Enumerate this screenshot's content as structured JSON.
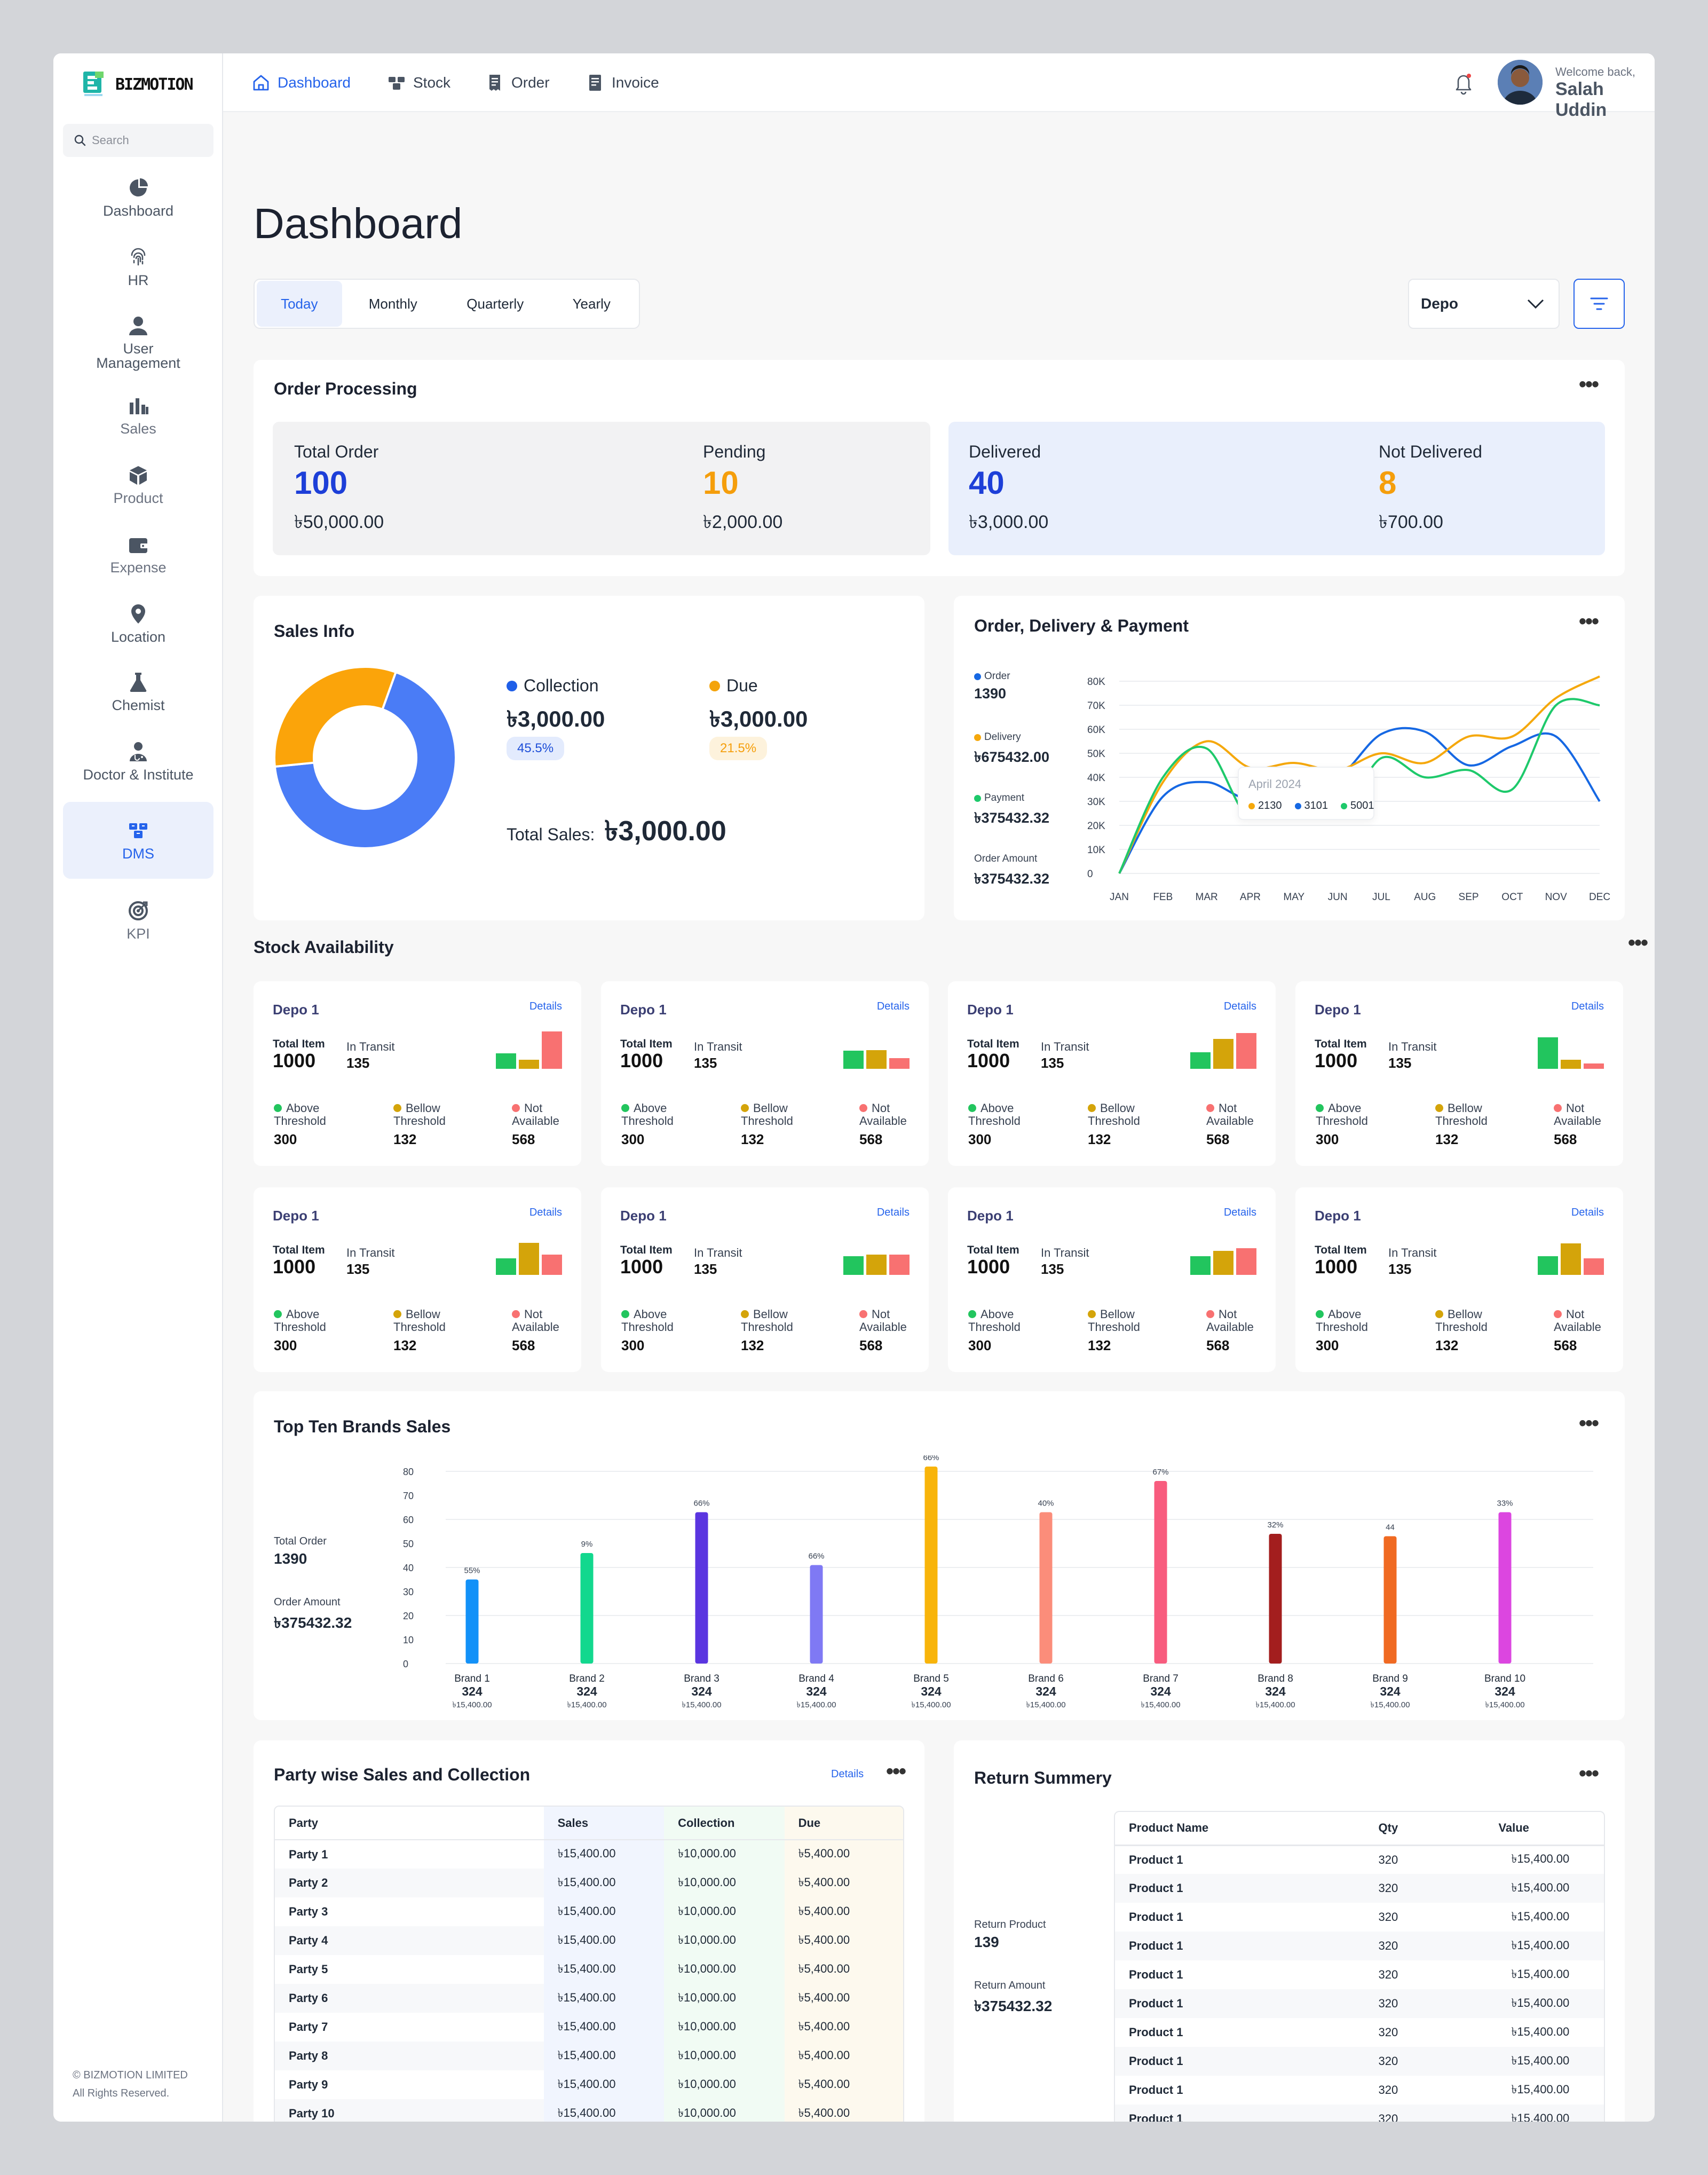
{
  "brand": {
    "logo_text": "BIZMOTION",
    "copyright_line1": "© BIZMOTION LIMITED",
    "copyright_line2": "All Rights Reserved."
  },
  "search": {
    "placeholder": "Search"
  },
  "sidebar": {
    "items": [
      {
        "label": "Dashboard",
        "icon": "pie-chart-icon"
      },
      {
        "label": "HR",
        "icon": "fingerprint-icon"
      },
      {
        "label": "User Management",
        "icon": "user-icon"
      },
      {
        "label": "Sales",
        "icon": "bar-chart-icon"
      },
      {
        "label": "Product",
        "icon": "box-icon"
      },
      {
        "label": "Expense",
        "icon": "wallet-icon"
      },
      {
        "label": "Location",
        "icon": "location-pin-icon"
      },
      {
        "label": "Chemist",
        "icon": "flask-icon"
      },
      {
        "label": "Doctor & Institute",
        "icon": "doctor-icon"
      },
      {
        "label": "DMS",
        "icon": "boxes-icon"
      },
      {
        "label": "KPI",
        "icon": "target-icon"
      }
    ],
    "active": "DMS"
  },
  "topnav": {
    "items": [
      {
        "label": "Dashboard",
        "icon": "home-icon"
      },
      {
        "label": "Stock",
        "icon": "boxes-icon"
      },
      {
        "label": "Order",
        "icon": "receipt-icon"
      },
      {
        "label": "Invoice",
        "icon": "invoice-icon"
      }
    ],
    "active": "Dashboard"
  },
  "user": {
    "welcome": "Welcome back,",
    "name": "Salah Uddin"
  },
  "page": {
    "title": "Dashboard"
  },
  "period_tabs": [
    "Today",
    "Monthly",
    "Quarterly",
    "Yearly"
  ],
  "active_tab": "Today",
  "depo_select": {
    "value": "Depo"
  },
  "order_processing": {
    "title": "Order Processing",
    "stats": [
      {
        "label": "Total Order",
        "value": "100",
        "amount": "৳50,000.00",
        "color": "#1d3fd8"
      },
      {
        "label": "Pending",
        "value": "10",
        "amount": "৳2,000.00",
        "color": "#f59e0b"
      },
      {
        "label": "Delivered",
        "value": "40",
        "amount": "৳3,000.00",
        "color": "#1d3fd8"
      },
      {
        "label": "Not Delivered",
        "value": "8",
        "amount": "৳700.00",
        "color": "#f59e0b"
      }
    ]
  },
  "sales_info": {
    "title": "Sales Info",
    "collection": {
      "label": "Collection",
      "amount": "৳3,000.00",
      "percent": "45.5%",
      "color": "#4a7cf6"
    },
    "due": {
      "label": "Due",
      "amount": "৳3,000.00",
      "percent": "21.5%",
      "color": "#fba40a"
    },
    "total_label": "Total Sales:",
    "total_value": "৳3,000.00"
  },
  "odp": {
    "title": "Order, Delivery & Payment",
    "legend": [
      {
        "label": "Order",
        "value": "1390",
        "color": "#1668e3"
      },
      {
        "label": "Delivery",
        "value": "৳675432.00",
        "color": "#f5a80c"
      },
      {
        "label": "Payment",
        "value": "৳375432.32",
        "color": "#1ec96b"
      },
      {
        "label": "Order Amount",
        "value": "৳375432.32",
        "color": ""
      }
    ],
    "tooltip": {
      "title": "April 2024",
      "items": [
        {
          "value": "2130",
          "color": "#f5a80c"
        },
        {
          "value": "3101",
          "color": "#1668e3"
        },
        {
          "value": "5001",
          "color": "#1ec96b"
        }
      ]
    }
  },
  "chart_data": [
    {
      "type": "line",
      "x": [
        "JAN",
        "FEB",
        "MAR",
        "APR",
        "MAY",
        "JUN",
        "JUL",
        "AUG",
        "SEP",
        "OCT",
        "NOV",
        "DEC"
      ],
      "yticks": [
        "80K",
        "70K",
        "60K",
        "50K",
        "40K",
        "30K",
        "20K",
        "10K",
        "0"
      ],
      "ylim": [
        0,
        80000
      ],
      "series": [
        {
          "name": "Order",
          "color": "#1668e3",
          "values": [
            0,
            32000,
            38000,
            31000,
            40000,
            40000,
            58000,
            59000,
            45000,
            53000,
            57000,
            30000
          ]
        },
        {
          "name": "Delivery",
          "color": "#f5a80c",
          "values": [
            0,
            38000,
            55000,
            44000,
            46000,
            43000,
            50000,
            46000,
            57000,
            57000,
            73000,
            82000
          ]
        },
        {
          "name": "Payment",
          "color": "#1ec96b",
          "values": [
            0,
            40000,
            52000,
            23000,
            38000,
            23000,
            48000,
            40000,
            43000,
            35000,
            70000,
            70000
          ]
        }
      ],
      "grid": true
    },
    {
      "type": "bar",
      "categories": [
        "Brand 1",
        "Brand 2",
        "Brand 3",
        "Brand 4",
        "Brand 5",
        "Brand 6",
        "Brand 7",
        "Brand 8",
        "Brand 9",
        "Brand 10"
      ],
      "values": [
        35,
        46,
        63,
        41,
        82,
        63,
        76,
        54,
        53,
        63
      ],
      "labels": [
        "55%",
        "9%",
        "66%",
        "66%",
        "66%",
        "40%",
        "67%",
        "32%",
        "44",
        "33%"
      ],
      "counts": [
        "324",
        "324",
        "324",
        "324",
        "324",
        "324",
        "324",
        "324",
        "324",
        "324"
      ],
      "amounts": [
        "৳15,400.00",
        "৳15,400.00",
        "৳15,400.00",
        "৳15,400.00",
        "৳15,400.00",
        "৳15,400.00",
        "৳15,400.00",
        "৳15,400.00",
        "৳15,400.00",
        "৳15,400.00"
      ],
      "colors": [
        "#1291f8",
        "#12d88e",
        "#5a35e0",
        "#7f79f4",
        "#f8b40a",
        "#fb8d7a",
        "#f85c7e",
        "#a31e1e",
        "#f06a22",
        "#dc46e0"
      ],
      "yticks": [
        "80",
        "70",
        "60",
        "50",
        "40",
        "30",
        "20",
        "10",
        "0"
      ],
      "ylim": [
        0,
        80
      ],
      "grid": true
    }
  ],
  "stock": {
    "title": "Stock Availability",
    "total_label": "Total Item",
    "transit_label": "In Transit",
    "details_label": "Details",
    "legend": [
      {
        "line1": "Above",
        "line2": "Threshold",
        "color": "#22c55e"
      },
      {
        "line1": "Bellow",
        "line2": "Threshold",
        "color": "#d4a40a"
      },
      {
        "line1": "Not",
        "line2": "Available",
        "color": "#f87171"
      }
    ],
    "cards": [
      {
        "name": "Depo 1",
        "total": "1000",
        "transit": "135",
        "values": [
          "300",
          "132",
          "568"
        ],
        "bars": [
          0.42,
          0.24,
          1.0
        ]
      },
      {
        "name": "Depo 1",
        "total": "1000",
        "transit": "135",
        "values": [
          "300",
          "132",
          "568"
        ],
        "bars": [
          0.48,
          0.5,
          0.28
        ]
      },
      {
        "name": "Depo 1",
        "total": "1000",
        "transit": "135",
        "values": [
          "300",
          "132",
          "568"
        ],
        "bars": [
          0.44,
          0.8,
          0.96
        ]
      },
      {
        "name": "Depo 1",
        "total": "1000",
        "transit": "135",
        "values": [
          "300",
          "132",
          "568"
        ],
        "bars": [
          0.84,
          0.24,
          0.14
        ]
      },
      {
        "name": "Depo 1",
        "total": "1000",
        "transit": "135",
        "values": [
          "300",
          "132",
          "568"
        ],
        "bars": [
          0.44,
          0.86,
          0.54
        ]
      },
      {
        "name": "Depo 1",
        "total": "1000",
        "transit": "135",
        "values": [
          "300",
          "132",
          "568"
        ],
        "bars": [
          0.5,
          0.54,
          0.54
        ]
      },
      {
        "name": "Depo 1",
        "total": "1000",
        "transit": "135",
        "values": [
          "300",
          "132",
          "568"
        ],
        "bars": [
          0.5,
          0.64,
          0.72
        ]
      },
      {
        "name": "Depo 1",
        "total": "1000",
        "transit": "135",
        "values": [
          "300",
          "132",
          "568"
        ],
        "bars": [
          0.5,
          0.84,
          0.44
        ]
      }
    ]
  },
  "brands": {
    "title": "Top Ten Brands Sales",
    "total_label": "Total Order",
    "total_value": "1390",
    "amount_label": "Order Amount",
    "amount_value": "৳375432.32"
  },
  "party": {
    "title": "Party wise Sales and Collection",
    "details_label": "Details",
    "columns": [
      "Party",
      "Sales",
      "Collection",
      "Due"
    ],
    "rows": [
      [
        "Party 1",
        "৳15,400.00",
        "৳10,000.00",
        "৳5,400.00"
      ],
      [
        "Party 2",
        "৳15,400.00",
        "৳10,000.00",
        "৳5,400.00"
      ],
      [
        "Party 3",
        "৳15,400.00",
        "৳10,000.00",
        "৳5,400.00"
      ],
      [
        "Party 4",
        "৳15,400.00",
        "৳10,000.00",
        "৳5,400.00"
      ],
      [
        "Party 5",
        "৳15,400.00",
        "৳10,000.00",
        "৳5,400.00"
      ],
      [
        "Party 6",
        "৳15,400.00",
        "৳10,000.00",
        "৳5,400.00"
      ],
      [
        "Party 7",
        "৳15,400.00",
        "৳10,000.00",
        "৳5,400.00"
      ],
      [
        "Party 8",
        "৳15,400.00",
        "৳10,000.00",
        "৳5,400.00"
      ],
      [
        "Party 9",
        "৳15,400.00",
        "৳10,000.00",
        "৳5,400.00"
      ],
      [
        "Party 10",
        "৳15,400.00",
        "৳10,000.00",
        "৳5,400.00"
      ]
    ]
  },
  "returns": {
    "title": "Return Summery",
    "product_label": "Return Product",
    "product_value": "139",
    "amount_label": "Return Amount",
    "amount_value": "৳375432.32",
    "columns": [
      "Product Name",
      "Qty",
      "Value"
    ],
    "rows": [
      [
        "Product 1",
        "320",
        "৳15,400.00"
      ],
      [
        "Product 1",
        "320",
        "৳15,400.00"
      ],
      [
        "Product 1",
        "320",
        "৳15,400.00"
      ],
      [
        "Product 1",
        "320",
        "৳15,400.00"
      ],
      [
        "Product 1",
        "320",
        "৳15,400.00"
      ],
      [
        "Product 1",
        "320",
        "৳15,400.00"
      ],
      [
        "Product 1",
        "320",
        "৳15,400.00"
      ],
      [
        "Product 1",
        "320",
        "৳15,400.00"
      ],
      [
        "Product 1",
        "320",
        "৳15,400.00"
      ],
      [
        "Product 1",
        "320",
        "৳15,400.00"
      ]
    ]
  }
}
